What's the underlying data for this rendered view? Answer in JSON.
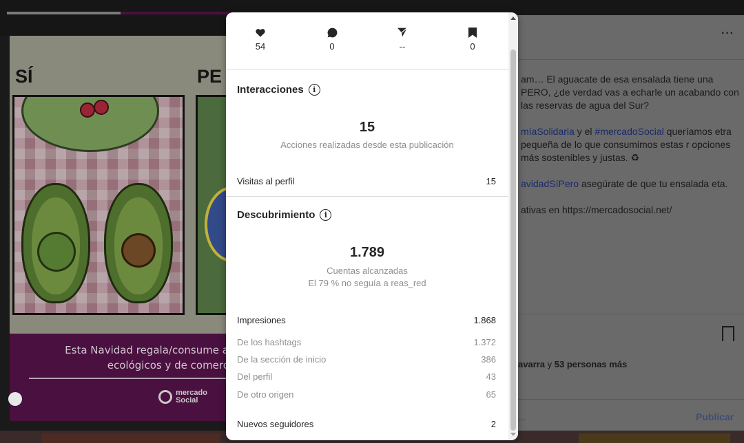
{
  "background_post": {
    "image": {
      "left_title": "SÍ",
      "right_title": "PE",
      "strip_text_line1": "Esta Navidad regala/consume a",
      "strip_text_line2": "ecológicos y de comerc",
      "logo_line1": "mercado",
      "logo_line2": "Social"
    },
    "more_label": "···",
    "caption": {
      "p1": "am… El aguacate de esa ensalada tiene una PERO, ¿de verdad vas a echarle un acabando con las reservas de agua del Sur?",
      "p2_hashtag1": "míaSolidaria",
      "p2_mid": " y el ",
      "p2_hashtag2": "#mercadoSocial",
      "p2_rest": " queríamos etra pequeña de lo que consumimos estas r opciones más sostenibles y justas. ♻",
      "p3_hashtag": "avidadSíPero",
      "p3_rest": " asegúrate de que tu ensalada eta.",
      "p4": "ativas en https://mercadosocial.net/"
    },
    "likes_prefix": "avarra",
    "likes_mid": " y ",
    "likes_bold": "53 personas más",
    "comment_placeholder": "...",
    "publish_label": "Publicar"
  },
  "insights": {
    "stats": [
      {
        "icon": "heart-icon",
        "value": "54"
      },
      {
        "icon": "comment-icon",
        "value": "0"
      },
      {
        "icon": "send-icon",
        "value": "--"
      },
      {
        "icon": "bookmark-icon",
        "value": "0"
      }
    ],
    "interactions": {
      "title": "Interacciones",
      "info": "i",
      "total": "15",
      "total_caption": "Acciones realizadas desde esta publicación",
      "rows": [
        {
          "label": "Visitas al perfil",
          "value": "15"
        }
      ]
    },
    "discovery": {
      "title": "Descubrimiento",
      "info": "i",
      "total": "1.789",
      "total_caption": "Cuentas alcanzadas",
      "followers_note": "El 79 % no seguía a reas_red",
      "impressions_label": "Impresiones",
      "impressions_value": "1.868",
      "sub_rows": [
        {
          "label": "De los hashtags",
          "value": "1.372"
        },
        {
          "label": "De la sección de inicio",
          "value": "386"
        },
        {
          "label": "Del perfil",
          "value": "43"
        },
        {
          "label": "De otro origen",
          "value": "65"
        }
      ],
      "new_followers_label": "Nuevos seguidores",
      "new_followers_value": "2"
    }
  }
}
